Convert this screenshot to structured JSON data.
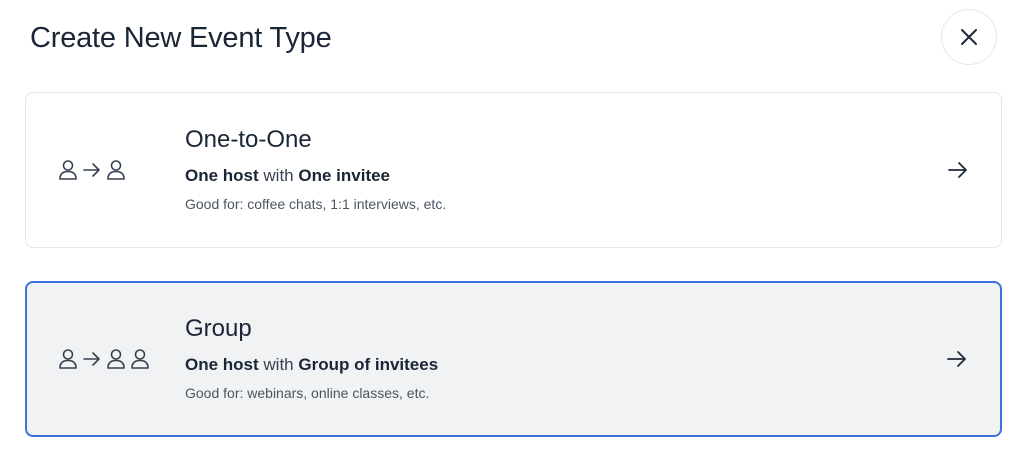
{
  "dialog": {
    "title": "Create New Event Type",
    "close_icon": "close-icon"
  },
  "options": [
    {
      "title": "One-to-One",
      "host_label": "One host",
      "connector": "with",
      "invitee_label": "One invitee",
      "description": "Good for: coffee chats, 1:1 interviews, etc.",
      "icons": [
        "person-icon",
        "arrow-right-icon",
        "person-icon"
      ],
      "selected": false
    },
    {
      "title": "Group",
      "host_label": "One host",
      "connector": "with",
      "invitee_label": "Group of invitees",
      "description": "Good for: webinars, online classes, etc.",
      "icons": [
        "person-icon",
        "arrow-right-icon",
        "person-icon",
        "person-icon"
      ],
      "selected": true
    }
  ],
  "colors": {
    "selected_border": "#3b73d9",
    "selected_background": "#f0f2f4",
    "text": "#1a2536"
  }
}
